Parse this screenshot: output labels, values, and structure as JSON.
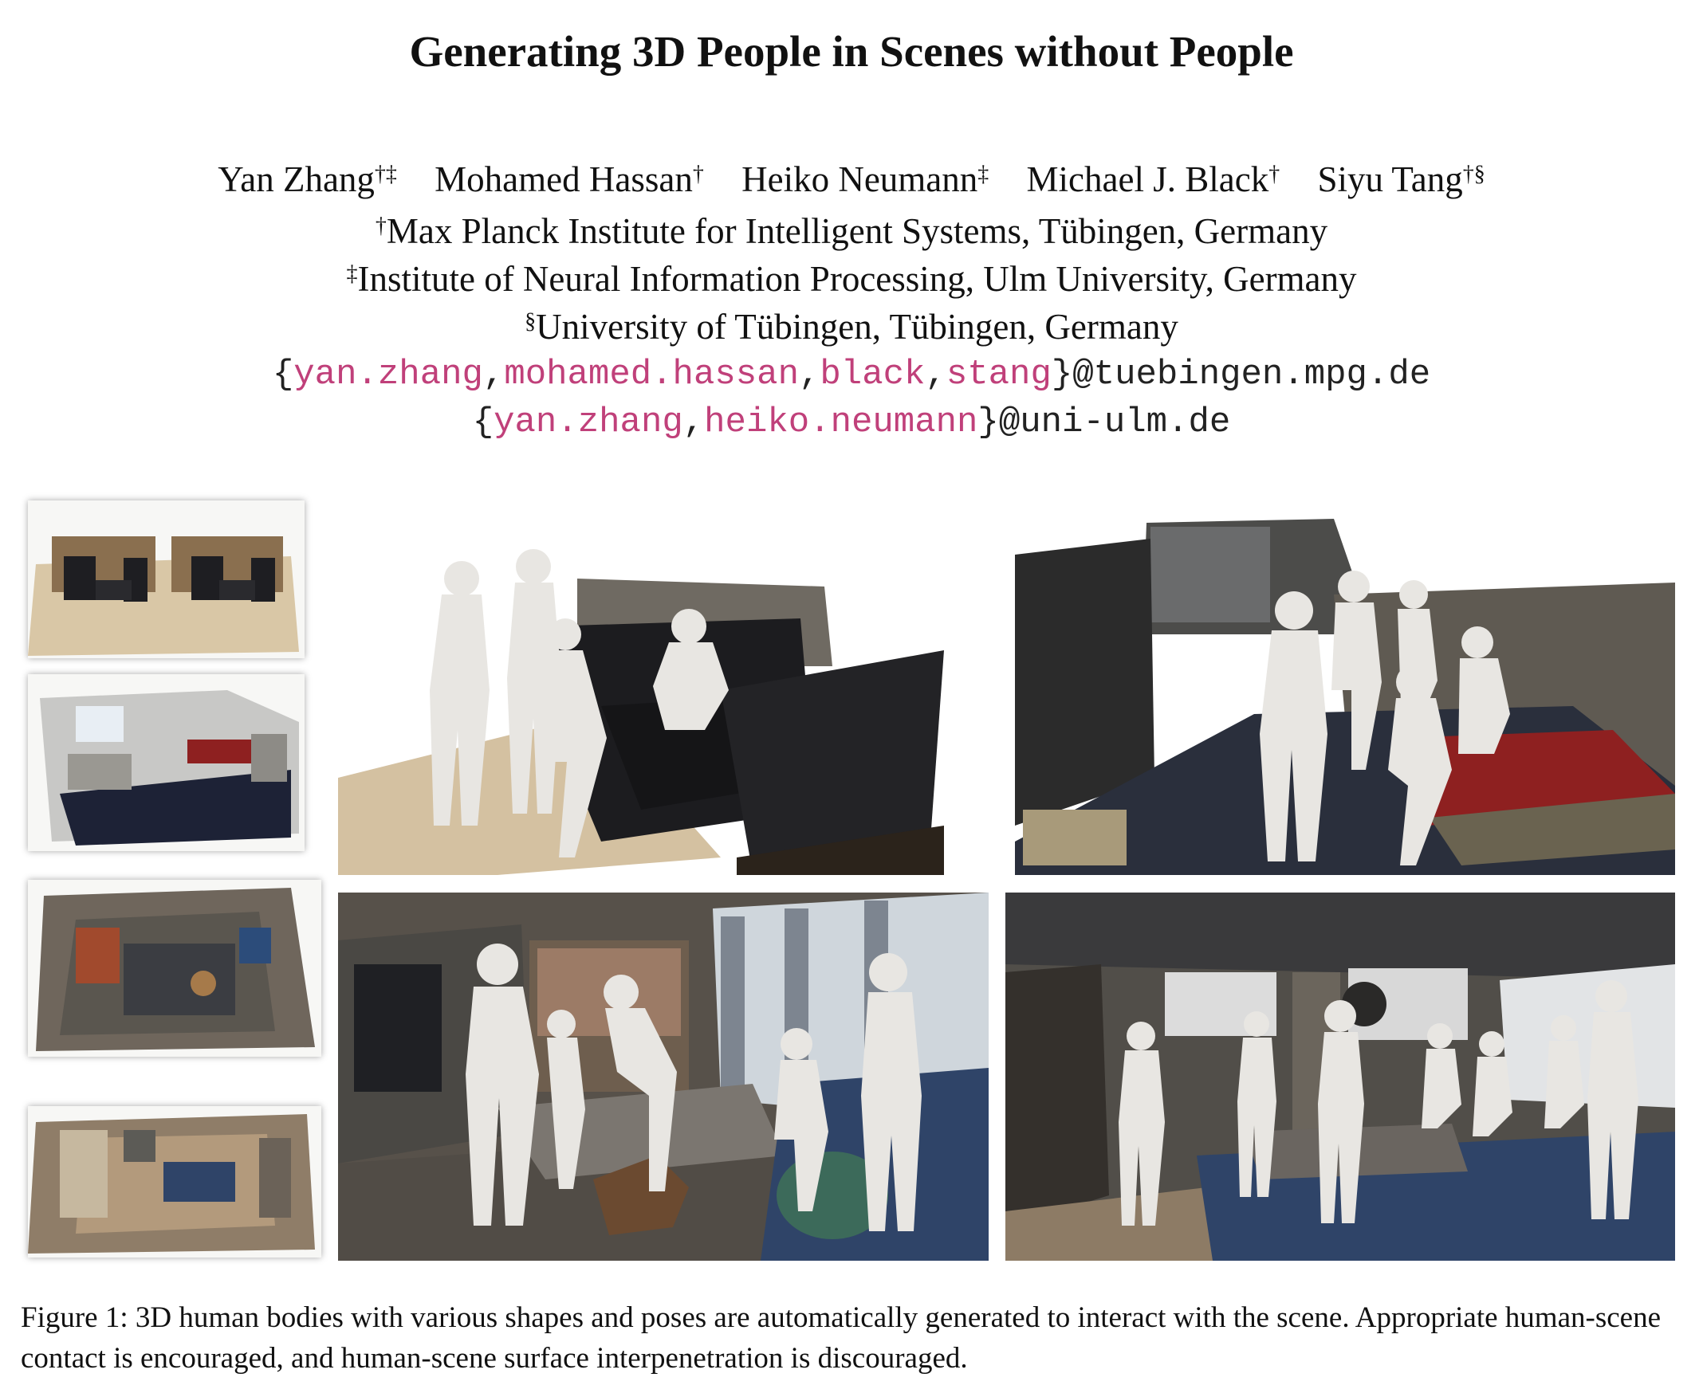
{
  "paper": {
    "title": "Generating 3D People in Scenes without People",
    "authors": [
      {
        "name": "Yan Zhang",
        "marks": "†‡"
      },
      {
        "name": "Mohamed Hassan",
        "marks": "†"
      },
      {
        "name": "Heiko Neumann",
        "marks": "‡"
      },
      {
        "name": "Michael J. Black",
        "marks": "†"
      },
      {
        "name": "Siyu Tang",
        "marks": "†§"
      }
    ],
    "affiliations": [
      {
        "mark": "†",
        "text": "Max Planck Institute for Intelligent Systems, Tübingen, Germany"
      },
      {
        "mark": "‡",
        "text": "Institute of Neural Information Processing, Ulm University, Germany"
      },
      {
        "mark": "§",
        "text": "University of Tübingen, Tübingen, Germany"
      }
    ],
    "emails": [
      {
        "open": "{",
        "users": [
          "yan.zhang",
          "mohamed.hassan",
          "black",
          "stang"
        ],
        "sep": ",",
        "close": "}",
        "domain": "@tuebingen.mpg.de"
      },
      {
        "open": "{",
        "users": [
          "yan.zhang",
          "heiko.neumann"
        ],
        "sep": ",",
        "close": "}",
        "domain": "@uni-ulm.de"
      }
    ],
    "figure_caption": "Figure 1: 3D human bodies with various shapes and poses are automatically generated to interact with the scene. Appropriate human-scene contact is encouraged, and human-scene surface interpenetration is discouraged."
  },
  "colors": {
    "email_user": "#c0407a",
    "body_figure": "#e8e6e2",
    "floor_wood": "#c9b08a",
    "dark_furniture": "#1f1f22",
    "sofa_blue": "#2f4468",
    "bed_red": "#8e2020"
  }
}
